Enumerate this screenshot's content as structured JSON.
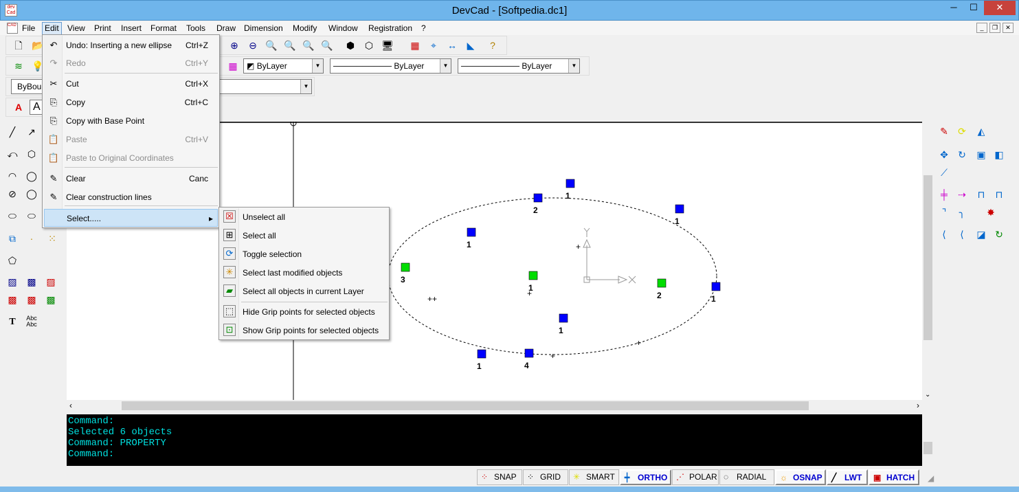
{
  "window": {
    "title": "DevCad - [Softpedia.dc1]",
    "minimize": "─",
    "maximize": "☐",
    "close": "✕"
  },
  "menubar": [
    "File",
    "Edit",
    "View",
    "Print",
    "Insert",
    "Format",
    "Tools",
    "Draw",
    "Dimension",
    "Modify",
    "Window",
    "Registration",
    "?"
  ],
  "toolbar": {
    "color_combo": "ByLayer",
    "linetype_combo": "ByLayer",
    "lineweight_combo": "ByLayer",
    "hatch_combo": "ByBou",
    "text_combo": "A"
  },
  "edit_menu": [
    {
      "label": "Undo: Inserting a new ellipse",
      "shortcut": "Ctrl+Z",
      "icon": "undo-icon",
      "disabled": false
    },
    {
      "label": "Redo",
      "shortcut": "Ctrl+Y",
      "icon": "redo-icon",
      "disabled": true
    },
    {
      "label": "Cut",
      "shortcut": "Ctrl+X",
      "icon": "scissors-icon",
      "disabled": false
    },
    {
      "label": "Copy",
      "shortcut": "Ctrl+C",
      "icon": "copy-icon",
      "disabled": false
    },
    {
      "label": "Copy with Base Point",
      "shortcut": "",
      "icon": "copy-base-icon",
      "disabled": false
    },
    {
      "label": "Paste",
      "shortcut": "Ctrl+V",
      "icon": "paste-icon",
      "disabled": true
    },
    {
      "label": "Paste to Original Coordinates",
      "shortcut": "",
      "icon": "paste-orig-icon",
      "disabled": true
    },
    {
      "label": "Clear",
      "shortcut": "Canc",
      "icon": "eraser-icon",
      "disabled": false
    },
    {
      "label": "Clear construction lines",
      "shortcut": "",
      "icon": "clear-lines-icon",
      "disabled": false
    },
    {
      "label": "Select.....",
      "shortcut": "",
      "icon": "",
      "disabled": false
    }
  ],
  "select_submenu": [
    "Unselect all",
    "Select all",
    "Toggle selection",
    "Select last modified objects",
    "Select all objects in current Layer",
    "Hide Grip points for selected objects",
    "Show Grip points for selected objects"
  ],
  "grip_labels": [
    "1",
    "2",
    "1",
    "1",
    "3",
    "1",
    "2",
    "1",
    "1",
    "1",
    "4"
  ],
  "console": [
    "Command:",
    "Selected 6 objects",
    "Command: PROPERTY",
    "Command:"
  ],
  "status": [
    "SNAP",
    "GRID",
    "SMART",
    "ORTHO",
    "POLAR",
    "RADIAL",
    "OSNAP",
    "LWT",
    "HATCH"
  ],
  "colors": {
    "grip_blue": "#0000ff",
    "grip_green": "#00dd00",
    "console_text": "#00e0e0",
    "status_on": "#0000d0"
  }
}
